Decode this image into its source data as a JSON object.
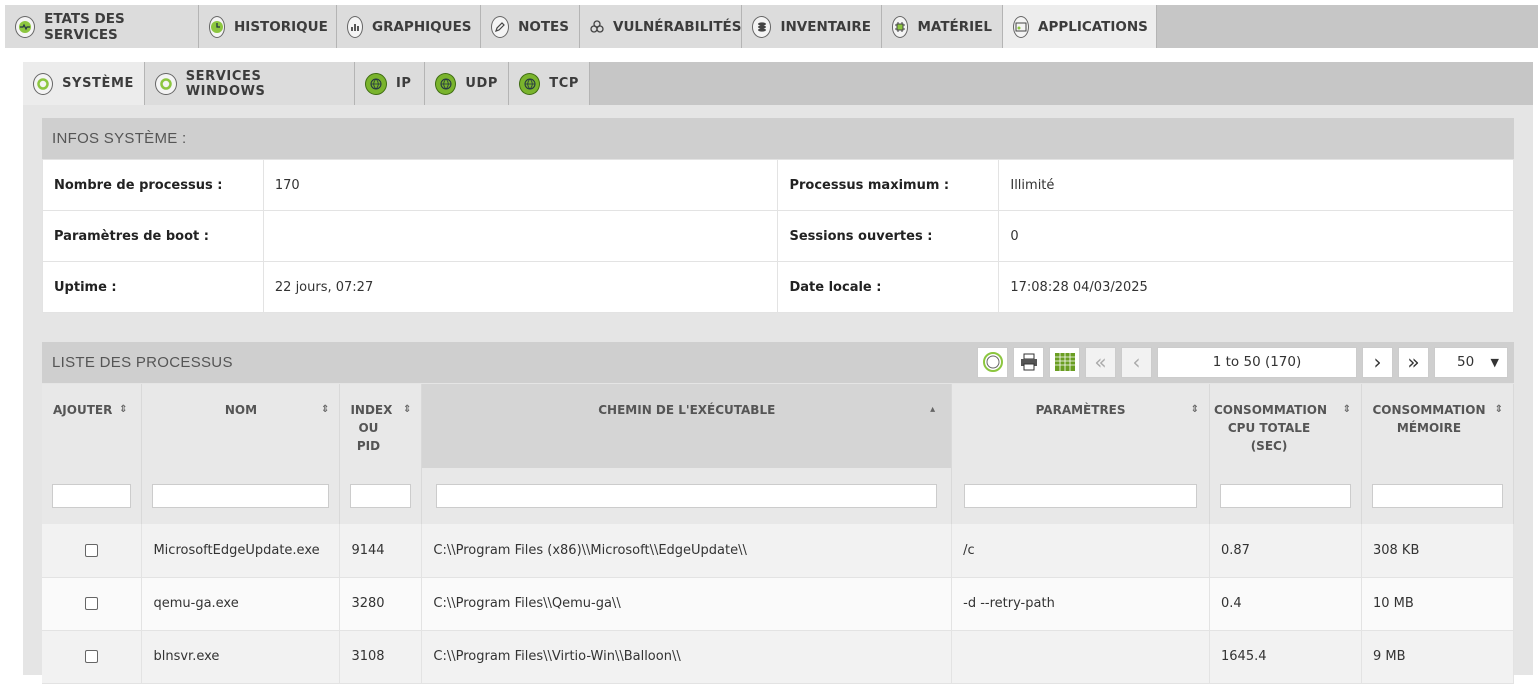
{
  "top_tabs": [
    {
      "label": "ETATS DES SERVICES",
      "icon": "heartbeat-icon"
    },
    {
      "label": "HISTORIQUE",
      "icon": "history-clock-icon"
    },
    {
      "label": "GRAPHIQUES",
      "icon": "bar-chart-icon"
    },
    {
      "label": "NOTES",
      "icon": "pencil-icon"
    },
    {
      "label": "VULNÉRABILITÉS",
      "icon": "biohazard-icon"
    },
    {
      "label": "INVENTAIRE",
      "icon": "database-icon"
    },
    {
      "label": "MATÉRIEL",
      "icon": "chip-icon"
    },
    {
      "label": "APPLICATIONS",
      "icon": "applications-window-icon"
    }
  ],
  "sub_tabs": [
    {
      "label": "SYSTÈME",
      "icon": "gear-icon"
    },
    {
      "label": "SERVICES WINDOWS",
      "icon": "gear-icon"
    },
    {
      "label": "IP",
      "icon": "globe-icon"
    },
    {
      "label": "UDP",
      "icon": "globe-icon"
    },
    {
      "label": "TCP",
      "icon": "globe-icon"
    }
  ],
  "infos": {
    "title": "INFOS SYSTÈME :",
    "rows": [
      {
        "k1": "Nombre de processus :",
        "v1": "170",
        "k2": "Processus maximum :",
        "v2": "Illimité"
      },
      {
        "k1": "Paramètres de boot :",
        "v1": "",
        "k2": "Sessions ouvertes :",
        "v2": "0"
      },
      {
        "k1": "Uptime :",
        "v1": "22 jours, 07:27",
        "k2": "Date locale :",
        "v2": "17:08:28 04/03/2025"
      }
    ]
  },
  "process_list": {
    "title": "LISTE DES PROCESSUS",
    "pager_text": "1 to 50 (170)",
    "page_size": "50",
    "columns": [
      {
        "label": "AJOUTER",
        "sort": "⇕"
      },
      {
        "label": "NOM",
        "sort": "⇕"
      },
      {
        "label": "INDEX OU PID",
        "sort": "⇕"
      },
      {
        "label": "CHEMIN DE L'EXÉCUTABLE",
        "sort": "▴"
      },
      {
        "label": "PARAMÈTRES",
        "sort": "⇕"
      },
      {
        "label": "CONSOMMATION CPU TOTALE (SEC)",
        "sort": "⇕"
      },
      {
        "label": "CONSOMMATION MÉMOIRE",
        "sort": "⇕"
      }
    ],
    "rows": [
      {
        "name": "MicrosoftEdgeUpdate.exe",
        "pid": "9144",
        "path": "C:\\\\Program Files (x86)\\\\Microsoft\\\\EdgeUpdate\\\\",
        "params": "/c",
        "cpu": "0.87",
        "mem": "308 KB"
      },
      {
        "name": "qemu-ga.exe",
        "pid": "3280",
        "path": "C:\\\\Program Files\\\\Qemu-ga\\\\",
        "params": "-d --retry-path",
        "cpu": "0.4",
        "mem": "10 MB"
      },
      {
        "name": "blnsvr.exe",
        "pid": "3108",
        "path": "C:\\\\Program Files\\\\Virtio-Win\\\\Balloon\\\\",
        "params": "",
        "cpu": "1645.4",
        "mem": "9 MB"
      }
    ]
  }
}
